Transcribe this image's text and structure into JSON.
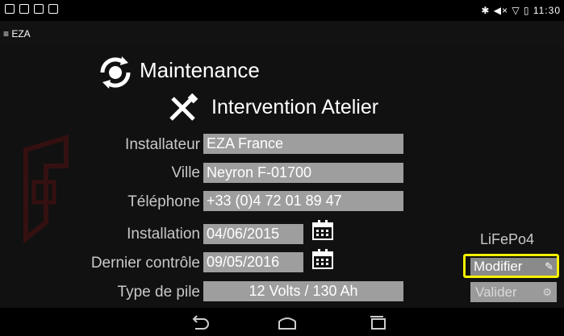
{
  "statusbar": {
    "time": "✱ ◀× ▽ ▯ 11:30"
  },
  "appbar": {
    "title": "≡ EZA"
  },
  "header": {
    "title": "Maintenance",
    "subtitle": "Intervention Atelier"
  },
  "form": {
    "installateur": {
      "label": "Installateur",
      "value": "EZA France"
    },
    "ville": {
      "label": "Ville",
      "value": "Neyron F-01700"
    },
    "telephone": {
      "label": "Téléphone",
      "value": "+33 (0)4 72 01 89 47"
    },
    "installation": {
      "label": "Installation",
      "value": "04/06/2015"
    },
    "dernier_controle": {
      "label": "Dernier contrôle",
      "value": "09/05/2016"
    },
    "type_pile": {
      "label": "Type de pile",
      "value": "12 Volts / 130 Ah"
    }
  },
  "side": {
    "battery_type": "LiFePo4",
    "modifier_label": "Modifier",
    "valider_label": "Valider"
  },
  "colors": {
    "highlight": "#f6f000",
    "field_bg": "#9e9e9e"
  }
}
